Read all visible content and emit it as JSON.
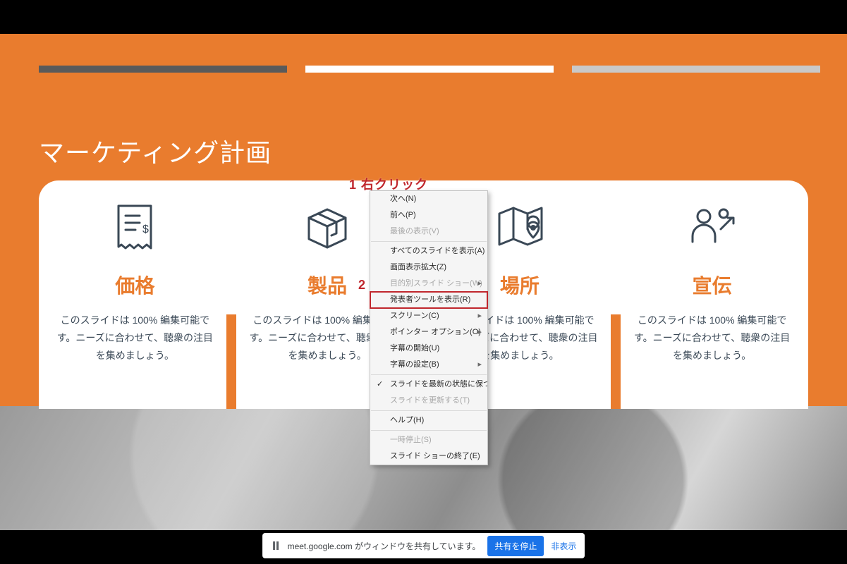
{
  "slide": {
    "title": "マーケティング計画",
    "columns": [
      {
        "icon": "receipt-icon",
        "heading": "価格",
        "body": "このスライドは 100% 編集可能です。ニーズに合わせて、聴衆の注目を集めましょう。"
      },
      {
        "icon": "box-icon",
        "heading": "製品",
        "body": "このスライドは 100% 編集可能です。ニーズに合わせて、聴衆の注目を集めましょう。"
      },
      {
        "icon": "map-pin-icon",
        "heading": "場所",
        "body": "このスライドは 100% 編集可能です。ニーズに合わせて、聴衆の注目を集めましょう。"
      },
      {
        "icon": "people-icon",
        "heading": "宣伝",
        "body": "このスライドは 100% 編集可能です。ニーズに合わせて、聴衆の注目を集めましょう。"
      }
    ]
  },
  "annotations": {
    "one": "1 右クリック",
    "two": "2"
  },
  "context_menu": {
    "items": [
      {
        "label": "次へ(N)",
        "disabled": false,
        "submenu": false,
        "checked": false,
        "highlight": false
      },
      {
        "label": "前へ(P)",
        "disabled": false,
        "submenu": false,
        "checked": false,
        "highlight": false
      },
      {
        "label": "最後の表示(V)",
        "disabled": true,
        "submenu": false,
        "checked": false,
        "highlight": false
      },
      {
        "sep": true
      },
      {
        "label": "すべてのスライドを表示(A)",
        "disabled": false,
        "submenu": false,
        "checked": false,
        "highlight": false
      },
      {
        "label": "画面表示拡大(Z)",
        "disabled": false,
        "submenu": false,
        "checked": false,
        "highlight": false
      },
      {
        "label": "目的別スライド ショー(W)",
        "disabled": true,
        "submenu": true,
        "checked": false,
        "highlight": false
      },
      {
        "label": "発表者ツールを表示(R)",
        "disabled": false,
        "submenu": false,
        "checked": false,
        "highlight": true
      },
      {
        "label": "スクリーン(C)",
        "disabled": false,
        "submenu": true,
        "checked": false,
        "highlight": false
      },
      {
        "label": "ポインター オプション(O)",
        "disabled": false,
        "submenu": true,
        "checked": false,
        "highlight": false
      },
      {
        "label": "字幕の開始(U)",
        "disabled": false,
        "submenu": false,
        "checked": false,
        "highlight": false
      },
      {
        "label": "字幕の設定(B)",
        "disabled": false,
        "submenu": true,
        "checked": false,
        "highlight": false
      },
      {
        "sep": true
      },
      {
        "label": "スライドを最新の状態に保つ(D)",
        "disabled": false,
        "submenu": false,
        "checked": true,
        "highlight": false
      },
      {
        "label": "スライドを更新する(T)",
        "disabled": true,
        "submenu": false,
        "checked": false,
        "highlight": false
      },
      {
        "sep": true
      },
      {
        "label": "ヘルプ(H)",
        "disabled": false,
        "submenu": false,
        "checked": false,
        "highlight": false
      },
      {
        "sep": true
      },
      {
        "label": "一時停止(S)",
        "disabled": true,
        "submenu": false,
        "checked": false,
        "highlight": false
      },
      {
        "label": "スライド ショーの終了(E)",
        "disabled": false,
        "submenu": false,
        "checked": false,
        "highlight": false
      }
    ]
  },
  "sharebar": {
    "text": "meet.google.com がウィンドウを共有しています。",
    "stop_label": "共有を停止",
    "hide_label": "非表示"
  }
}
